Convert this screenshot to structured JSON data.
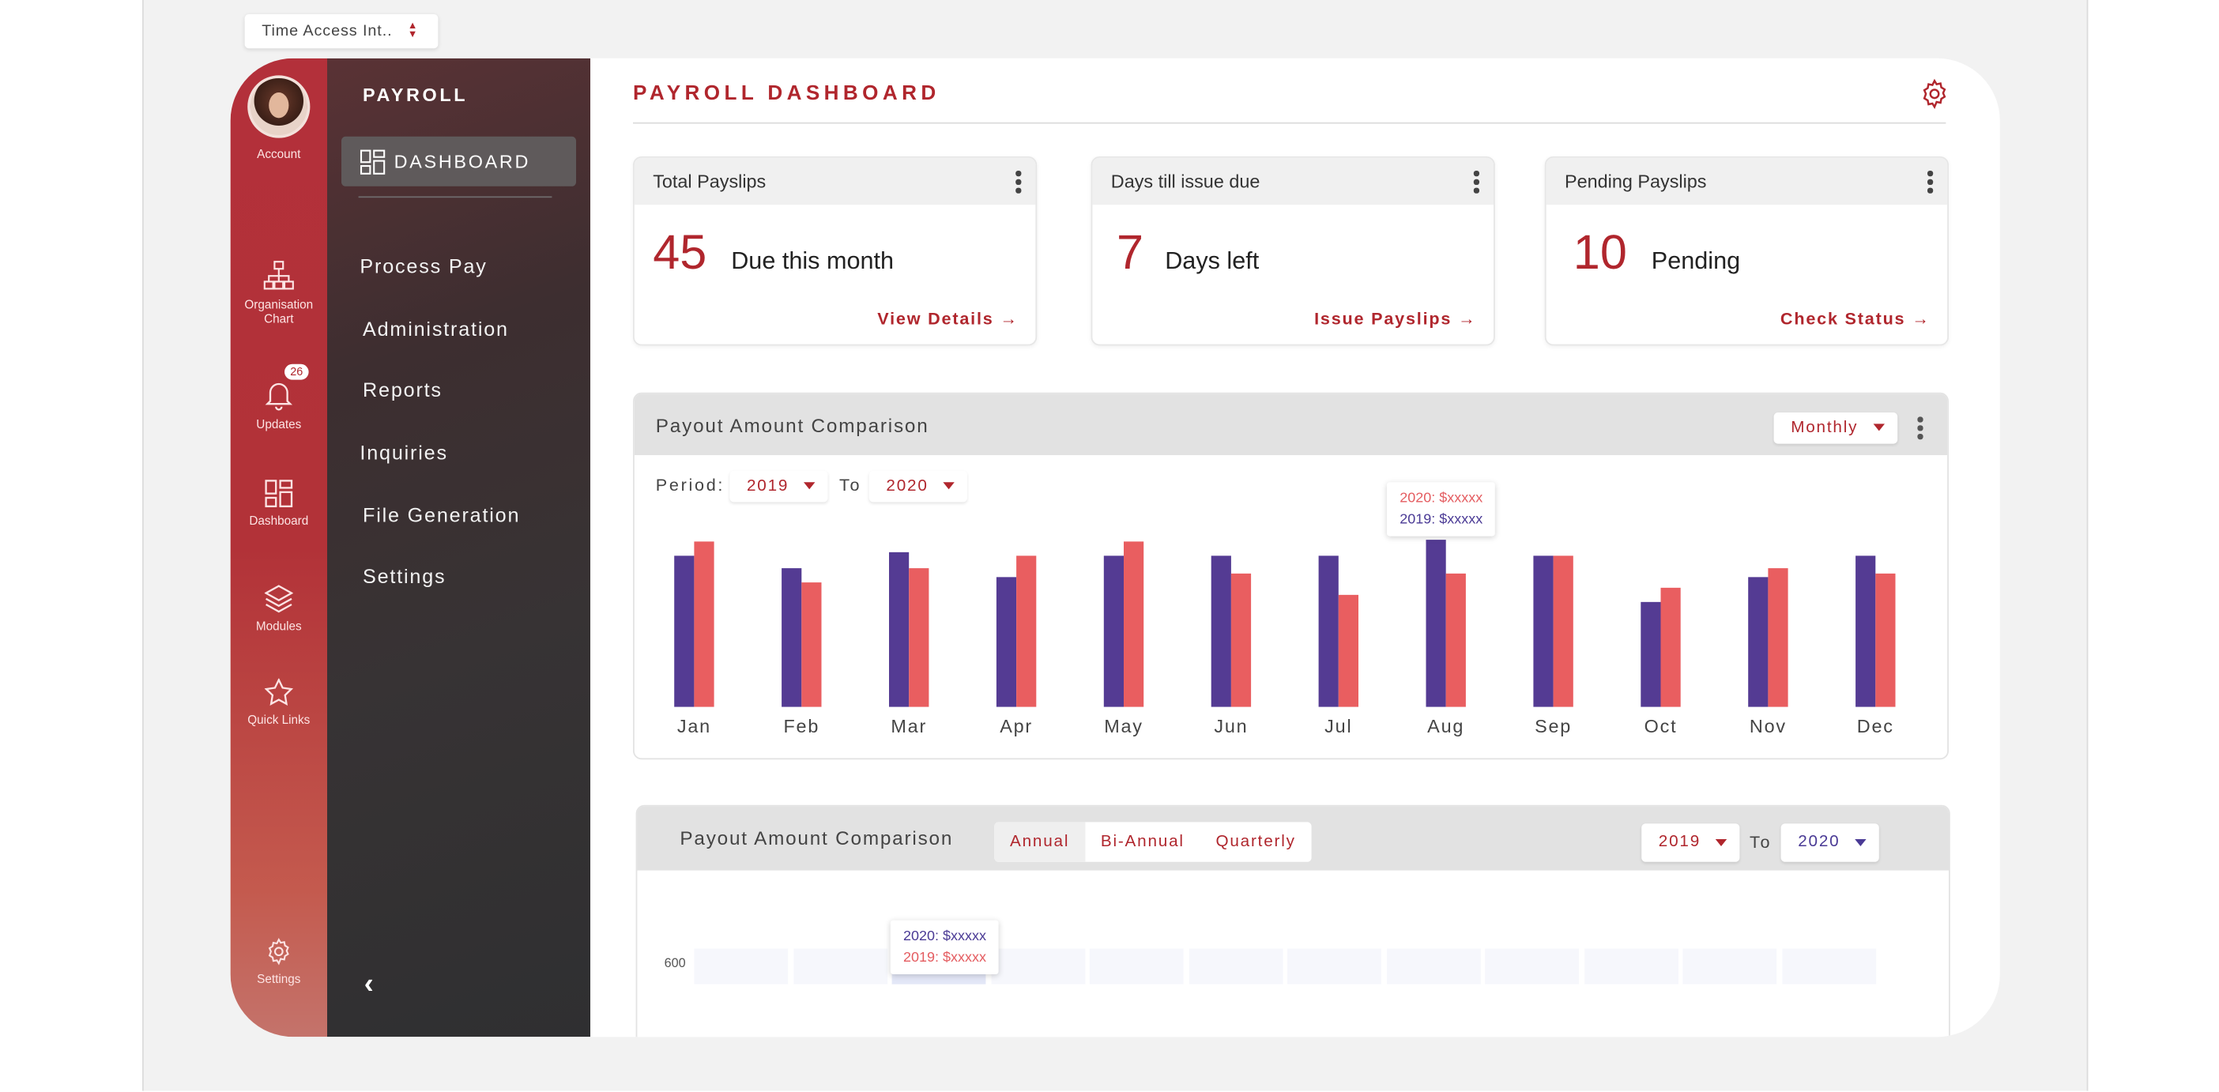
{
  "top_select": {
    "value": "Time Access Int.."
  },
  "rail": {
    "account": "Account",
    "org_chart_1": "Organisation",
    "org_chart_2": "Chart",
    "updates": "Updates",
    "updates_badge": "26",
    "dashboard": "Dashboard",
    "modules": "Modules",
    "quick_links": "Quick Links",
    "settings": "Settings"
  },
  "nav": {
    "title": "PAYROLL",
    "active": "DASHBOARD",
    "items": [
      "Process Pay",
      "Administration",
      "Reports",
      "Inquiries",
      "File Generation",
      "Settings"
    ]
  },
  "main": {
    "title": "PAYROLL DASHBOARD",
    "cards": [
      {
        "title": "Total Payslips",
        "value": "45",
        "desc": "Due this month",
        "action": "View Details"
      },
      {
        "title": "Days till issue due",
        "value": "7",
        "desc": "Days left",
        "action": "Issue Payslips"
      },
      {
        "title": "Pending Payslips",
        "value": "10",
        "desc": "Pending",
        "action": "Check Status"
      }
    ]
  },
  "panel1": {
    "title": "Payout Amount Comparison",
    "granularity": "Monthly",
    "period_label": "Period:",
    "from": "2019",
    "to_label": "To",
    "to": "2020",
    "tooltip": {
      "line1": "2020: $xxxxx",
      "line2": "2019: $xxxxx"
    }
  },
  "panel2": {
    "title": "Payout Amount Comparison",
    "tabs": [
      "Annual",
      "Bi-Annual",
      "Quarterly"
    ],
    "active_tab": "Annual",
    "from": "2019",
    "to_label": "To",
    "to": "2020",
    "y_tick": "600",
    "tooltip": {
      "line1": "2020: $xxxxx",
      "line2": "2019: $xxxxx"
    }
  },
  "colors": {
    "accent": "#b0262d",
    "series_2019": "#543b93",
    "series_2020": "#e95e60"
  },
  "chart_data": {
    "type": "bar",
    "categories": [
      "Jan",
      "Feb",
      "Mar",
      "Apr",
      "May",
      "Jun",
      "Jul",
      "Aug",
      "Sep",
      "Oct",
      "Nov",
      "Dec"
    ],
    "series": [
      {
        "name": "2019",
        "values": [
          85,
          78,
          87,
          73,
          85,
          85,
          85,
          94,
          85,
          59,
          73,
          85
        ]
      },
      {
        "name": "2020",
        "values": [
          93,
          70,
          78,
          85,
          93,
          75,
          63,
          75,
          85,
          67,
          78,
          75
        ]
      }
    ],
    "ylim": [
      0,
      100
    ],
    "title": "",
    "xlabel": "",
    "ylabel": "",
    "grid": false
  }
}
